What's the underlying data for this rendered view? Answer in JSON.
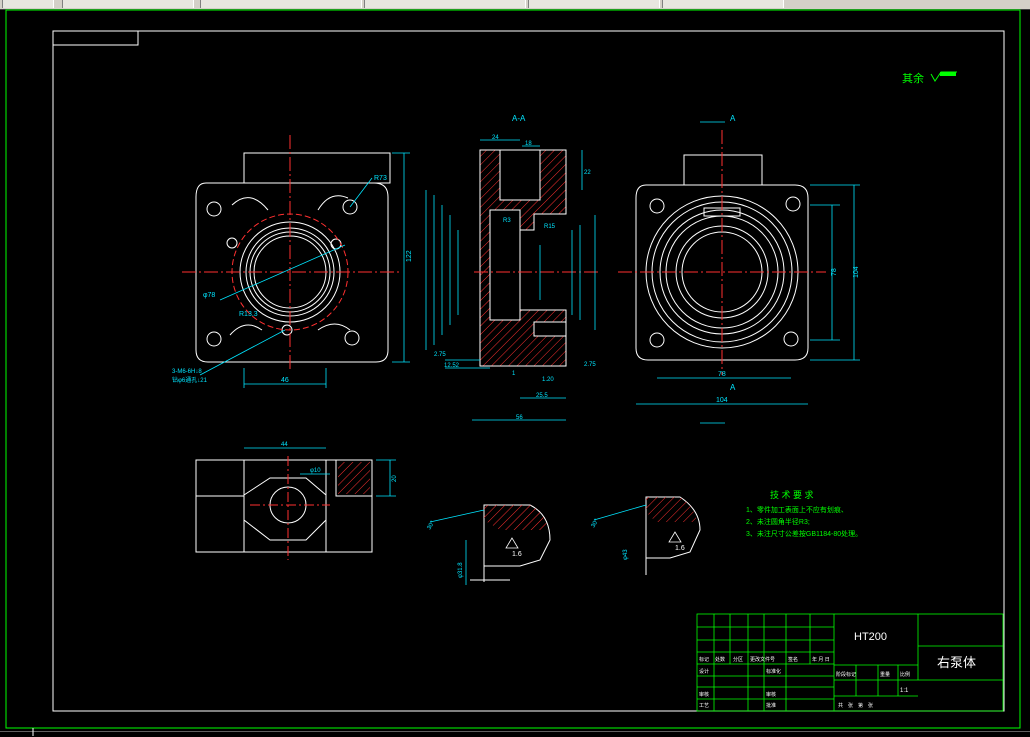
{
  "toolbar": {
    "tabs": [
      "",
      "",
      "",
      "",
      ""
    ]
  },
  "drawing": {
    "roughness_note": "其余",
    "section_label": "A-A",
    "section_mark": "A",
    "material": "HT200",
    "part_name": "右泵体",
    "scale": "1:1",
    "tech_title": "技 术 要 求",
    "tech_items": [
      "1、零件加工表面上不应有划痕、",
      "2、未注圆角半径R3;",
      "3、未注尺寸公差按GB1184-80处理。"
    ],
    "dims": {
      "r73": "R73",
      "d122": "122",
      "phi78": "φ78",
      "r133": "R13.3",
      "holes": "3-M6-6H↓8",
      "holes2": "钻φ6通孔↓21",
      "d46": "46",
      "d24": "24",
      "d18": "18",
      "d22": "22",
      "r3": "R3",
      "r15": "R15",
      "d275a": "2.75",
      "d1252": "12.52",
      "d1": "1",
      "d120": "1.20",
      "d255": "25.5",
      "d275b": "2.75",
      "d56": "56",
      "d78": "78",
      "d104": "104",
      "d78b": "78",
      "d104b": "104",
      "d44": "44",
      "phi10": "φ10",
      "d20": "20",
      "r16": "1.6",
      "r16b": "1.6",
      "d30a": "30°",
      "d30b": "30°",
      "phi318": "φ31.8",
      "phi43": "φ43"
    },
    "title_block": {
      "row_labels": [
        "标记",
        "处数",
        "分区",
        "更改文件号",
        "签名",
        "年 月 日"
      ],
      "design": "设计",
      "standard": "标准化",
      "stage": "阶段标记",
      "weight": "重量",
      "scale_lbl": "比例",
      "review": "审核",
      "process": "工艺",
      "approve": "批准",
      "sheets": "共　张　第　张",
      "check": "审核"
    }
  }
}
